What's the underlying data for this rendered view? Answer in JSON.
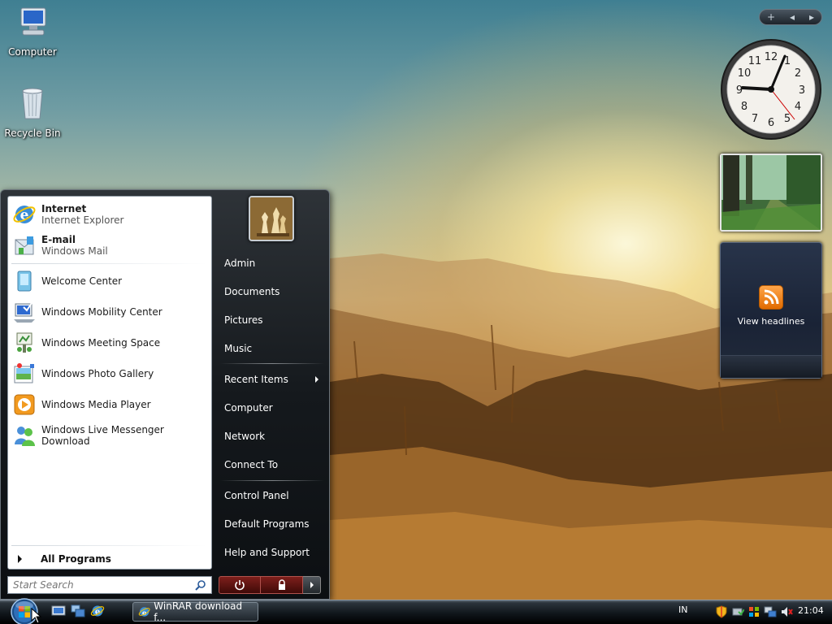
{
  "desktop": {
    "icons": [
      {
        "label": "Computer"
      },
      {
        "label": "Recycle Bin"
      }
    ]
  },
  "sidebar": {
    "controls": {
      "add": "+",
      "prev": "◂",
      "next": "▸"
    },
    "clock": {
      "numbers": [
        "12",
        "1",
        "2",
        "3",
        "4",
        "5",
        "6",
        "7",
        "8",
        "9",
        "10",
        "11"
      ]
    },
    "feed": {
      "label": "View headlines"
    }
  },
  "start_menu": {
    "pinned": [
      {
        "title": "Internet",
        "subtitle": "Internet Explorer"
      },
      {
        "title": "E-mail",
        "subtitle": "Windows Mail"
      }
    ],
    "recent": [
      {
        "label": "Welcome Center"
      },
      {
        "label": "Windows Mobility Center"
      },
      {
        "label": "Windows Meeting Space"
      },
      {
        "label": "Windows Photo Gallery"
      },
      {
        "label": "Windows Media Player"
      },
      {
        "label": "Windows Live Messenger Download"
      }
    ],
    "all_programs": "All Programs",
    "search_placeholder": "Start Search",
    "right_items": [
      {
        "label": "Admin"
      },
      {
        "label": "Documents"
      },
      {
        "label": "Pictures"
      },
      {
        "label": "Music"
      },
      {
        "label": "Recent Items"
      },
      {
        "label": "Computer"
      },
      {
        "label": "Network"
      },
      {
        "label": "Connect To"
      },
      {
        "label": "Control Panel"
      },
      {
        "label": "Default Programs"
      },
      {
        "label": "Help and Support"
      }
    ]
  },
  "taskbar": {
    "task": "WinRAR download f...",
    "language": "IN",
    "time": "21:04"
  },
  "colors": {
    "accent": "#3a8ed8",
    "power_red": "#7e1f1b"
  }
}
